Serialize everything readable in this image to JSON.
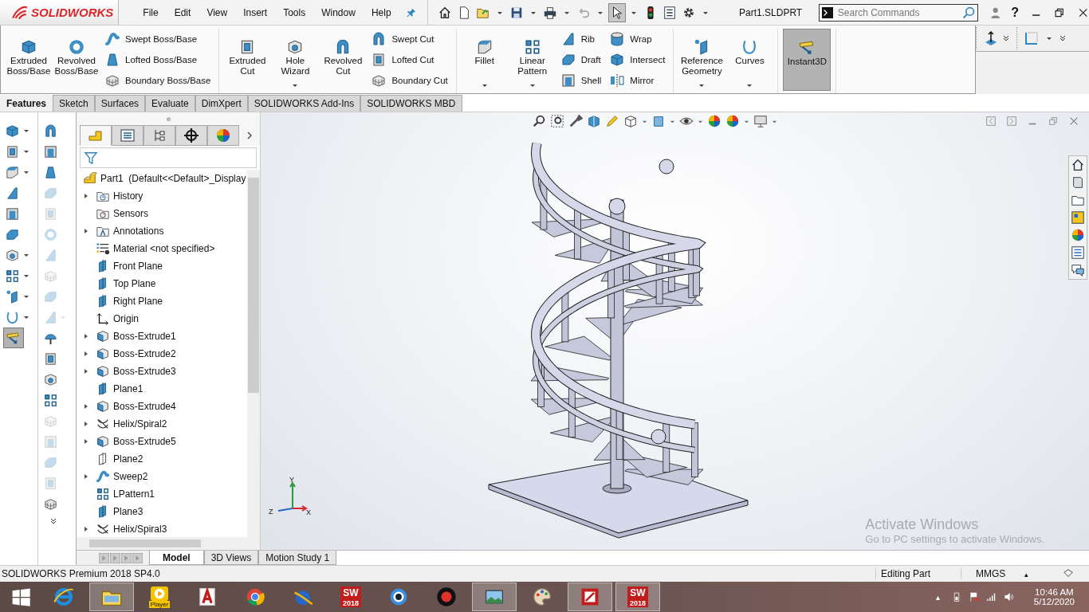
{
  "app": {
    "name": "SOLIDWORKS"
  },
  "menu": [
    "File",
    "Edit",
    "View",
    "Insert",
    "Tools",
    "Window",
    "Help"
  ],
  "quick_access": [
    {
      "kind": "home",
      "selected": false
    },
    {
      "kind": "new",
      "selected": false
    },
    {
      "kind": "open",
      "selected": false
    },
    {
      "kind": "save",
      "selected": false
    },
    {
      "kind": "print",
      "selected": false
    },
    {
      "kind": "undo",
      "selected": false
    },
    {
      "kind": "select",
      "selected": true
    },
    {
      "kind": "rebuild",
      "selected": false
    },
    {
      "kind": "properties",
      "selected": false
    },
    {
      "kind": "options",
      "selected": false
    }
  ],
  "document_title": "Part1.SLDPRT",
  "search": {
    "placeholder": "Search Commands"
  },
  "help": "?",
  "ribbon": [
    {
      "items": [
        {
          "kind": "large",
          "label": "Extruded Boss/Base",
          "dropdown": false,
          "selected": false
        },
        {
          "kind": "large",
          "label": "Revolved Boss/Base",
          "dropdown": false,
          "selected": false
        },
        {
          "kind": "stack",
          "tools": [
            {
              "label": "Swept Boss/Base",
              "selected": false
            },
            {
              "label": "Lofted Boss/Base",
              "selected": false
            },
            {
              "label": "Boundary Boss/Base",
              "selected": false
            }
          ]
        }
      ]
    },
    {
      "items": [
        {
          "kind": "large",
          "label": "Extruded Cut",
          "dropdown": false,
          "selected": false
        },
        {
          "kind": "large",
          "label": "Hole Wizard",
          "dropdown": true,
          "selected": false
        },
        {
          "kind": "large",
          "label": "Revolved Cut",
          "dropdown": false,
          "selected": false
        },
        {
          "kind": "stack",
          "tools": [
            {
              "label": "Swept Cut",
              "selected": false
            },
            {
              "label": "Lofted Cut",
              "selected": false
            },
            {
              "label": "Boundary Cut",
              "selected": false
            }
          ]
        }
      ]
    },
    {
      "items": [
        {
          "kind": "large",
          "label": "Fillet",
          "dropdown": true,
          "selected": false
        },
        {
          "kind": "large",
          "label": "Linear Pattern",
          "dropdown": true,
          "selected": false
        },
        {
          "kind": "stack",
          "tools": [
            {
              "label": "Rib",
              "selected": false
            },
            {
              "label": "Draft",
              "selected": false
            },
            {
              "label": "Shell",
              "selected": false
            }
          ]
        },
        {
          "kind": "stack",
          "tools": [
            {
              "label": "Wrap",
              "selected": false
            },
            {
              "label": "Intersect",
              "selected": false
            },
            {
              "label": "Mirror",
              "selected": false
            }
          ]
        }
      ]
    },
    {
      "items": [
        {
          "kind": "large",
          "label": "Reference Geometry",
          "dropdown": true,
          "selected": false
        },
        {
          "kind": "large",
          "label": "Curves",
          "dropdown": true,
          "selected": false
        }
      ]
    },
    {
      "items": [
        {
          "kind": "large",
          "label": "Instant3D",
          "dropdown": false,
          "selected": true
        }
      ]
    }
  ],
  "tabs": [
    {
      "label": "Features",
      "selected": true
    },
    {
      "label": "Sketch",
      "selected": false
    },
    {
      "label": "Surfaces",
      "selected": false
    },
    {
      "label": "Evaluate",
      "selected": false
    },
    {
      "label": "DimXpert",
      "selected": false
    },
    {
      "label": "SOLIDWORKS Add-Ins",
      "selected": false
    },
    {
      "label": "SOLIDWORKS MBD",
      "selected": false
    }
  ],
  "left_toolbar": [
    {
      "dropdown": true,
      "selected": false
    },
    {
      "dropdown": true,
      "selected": false
    },
    {
      "dropdown": true,
      "selected": false
    },
    {
      "dropdown": false,
      "selected": false
    },
    {
      "dropdown": false,
      "selected": false
    },
    {
      "dropdown": false,
      "selected": false
    },
    {
      "dropdown": true,
      "selected": false
    },
    {
      "dropdown": true,
      "selected": false
    },
    {
      "dropdown": true,
      "selected": false
    },
    {
      "dropdown": true,
      "selected": false
    },
    {
      "dropdown": false,
      "selected": true
    }
  ],
  "left_toolbar_2": [
    {
      "dropdown": false,
      "disabled": false
    },
    {
      "dropdown": false,
      "disabled": false
    },
    {
      "dropdown": false,
      "disabled": false
    },
    {
      "dropdown": false,
      "disabled": true
    },
    {
      "dropdown": false,
      "disabled": true
    },
    {
      "dropdown": false,
      "disabled": true
    },
    {
      "dropdown": false,
      "disabled": true
    },
    {
      "dropdown": false,
      "disabled": true
    },
    {
      "dropdown": false,
      "disabled": true
    },
    {
      "dropdown": true,
      "disabled": true
    },
    {
      "dropdown": false,
      "disabled": false
    },
    {
      "dropdown": false,
      "disabled": false
    },
    {
      "dropdown": false,
      "disabled": false
    },
    {
      "dropdown": false,
      "disabled": false
    },
    {
      "dropdown": false,
      "disabled": true
    },
    {
      "dropdown": false,
      "disabled": true
    },
    {
      "dropdown": false,
      "disabled": true
    },
    {
      "dropdown": false,
      "disabled": true
    },
    {
      "dropdown": false,
      "disabled": false
    }
  ],
  "panel_tabs": [
    {
      "kind": "tree",
      "selected": true
    },
    {
      "kind": "property",
      "selected": false
    },
    {
      "kind": "config",
      "selected": false
    },
    {
      "kind": "target",
      "selected": false
    },
    {
      "kind": "display",
      "selected": false
    }
  ],
  "tree": {
    "label": "Part1  (Default<<Default>_Display",
    "kind": "part",
    "children": [
      {
        "label": "History",
        "kind": "history",
        "collapsed": true
      },
      {
        "label": "Sensors",
        "kind": "sensor",
        "collapsed": false
      },
      {
        "label": "Annotations",
        "kind": "annotation",
        "collapsed": true
      },
      {
        "label": "Material <not specified>",
        "kind": "material",
        "collapsed": false
      },
      {
        "label": "Front Plane",
        "kind": "plane",
        "collapsed": false
      },
      {
        "label": "Top Plane",
        "kind": "plane",
        "collapsed": false
      },
      {
        "label": "Right Plane",
        "kind": "plane",
        "collapsed": false
      },
      {
        "label": "Origin",
        "kind": "origin",
        "collapsed": false
      },
      {
        "label": "Boss-Extrude1",
        "kind": "extrude",
        "collapsed": true
      },
      {
        "label": "Boss-Extrude2",
        "kind": "extrude",
        "collapsed": true
      },
      {
        "label": "Boss-Extrude3",
        "kind": "extrude",
        "collapsed": true
      },
      {
        "label": "Plane1",
        "kind": "plane",
        "collapsed": false
      },
      {
        "label": "Boss-Extrude4",
        "kind": "extrude",
        "collapsed": true
      },
      {
        "label": "Helix/Spiral2",
        "kind": "helix",
        "collapsed": true
      },
      {
        "label": "Boss-Extrude5",
        "kind": "extrude",
        "collapsed": true
      },
      {
        "label": "Plane2",
        "kind": "planeout",
        "collapsed": false
      },
      {
        "label": "Sweep2",
        "kind": "sweep",
        "collapsed": true
      },
      {
        "label": "LPattern1",
        "kind": "pattern",
        "collapsed": false
      },
      {
        "label": "Plane3",
        "kind": "plane",
        "collapsed": false
      },
      {
        "label": "Helix/Spiral3",
        "kind": "helix",
        "collapsed": true
      }
    ]
  },
  "triad": {
    "x": "X",
    "y": "Y",
    "z": "Z"
  },
  "activation": {
    "title": "Activate Windows",
    "message": "Go to PC settings to activate Windows."
  },
  "bottom_tabs": [
    {
      "label": "Model",
      "selected": true
    },
    {
      "label": "3D Views",
      "selected": false
    },
    {
      "label": "Motion Study 1",
      "selected": false
    }
  ],
  "status_bar": {
    "product": "SOLIDWORKS Premium 2018 SP4.0",
    "mode": "Editing Part",
    "units": "MMGS",
    "units_arrow": "▴"
  },
  "taskbar": [
    {
      "kind": "start",
      "running": false
    },
    {
      "kind": "ie",
      "running": false
    },
    {
      "kind": "folder",
      "running": true
    },
    {
      "kind": "player",
      "label": "Player",
      "running": false
    },
    {
      "kind": "redapp",
      "running": false
    },
    {
      "kind": "chrome",
      "running": false
    },
    {
      "kind": "globe",
      "running": false
    },
    {
      "kind": "sw",
      "mark": "SW",
      "label": "2018",
      "running": false
    },
    {
      "kind": "aperture",
      "running": false
    },
    {
      "kind": "record",
      "running": false
    },
    {
      "kind": "photo",
      "running": true
    },
    {
      "kind": "palette",
      "running": false
    },
    {
      "kind": "redbox",
      "running": true
    },
    {
      "kind": "sw",
      "mark": "SW",
      "label": "2018",
      "running": true
    }
  ],
  "tray": {
    "arrow": "▴",
    "time": "10:46 AM",
    "date": "5/12/2020"
  }
}
